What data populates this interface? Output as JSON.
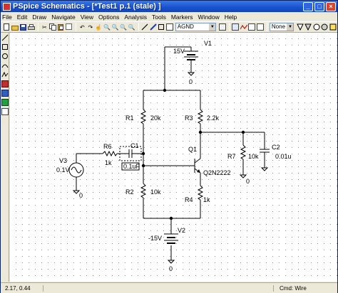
{
  "window": {
    "title": "PSpice Schematics - [*Test1  p.1  (stale) ]"
  },
  "menu": [
    "File",
    "Edit",
    "Draw",
    "Navigate",
    "View",
    "Options",
    "Analysis",
    "Tools",
    "Markers",
    "Window",
    "Help"
  ],
  "toolbar": {
    "part_combo_value": "AGND",
    "marker_combo_value": "None"
  },
  "circuit": {
    "v1": {
      "ref": "V1",
      "value": "15V"
    },
    "v2": {
      "ref": "V2",
      "value": "-15V"
    },
    "v3": {
      "ref": "V3",
      "value": "0.1V"
    },
    "r1": {
      "ref": "R1",
      "value": "20k"
    },
    "r2": {
      "ref": "R2",
      "value": "10k"
    },
    "r3": {
      "ref": "R3",
      "value": "2.2k"
    },
    "r4": {
      "ref": "R4",
      "value": "1k"
    },
    "r6": {
      "ref": "R6",
      "value": "1k"
    },
    "r7": {
      "ref": "R7",
      "value": "10k"
    },
    "c1": {
      "ref": "C1",
      "value": "0.1uF"
    },
    "c2": {
      "ref": "C2",
      "value": "0.01u"
    },
    "q1": {
      "ref": "Q1",
      "value": "Q2N2222"
    },
    "ground_label": "0"
  },
  "status": {
    "coords": "2.17, 0.44",
    "command": "Cmd: Wire"
  }
}
